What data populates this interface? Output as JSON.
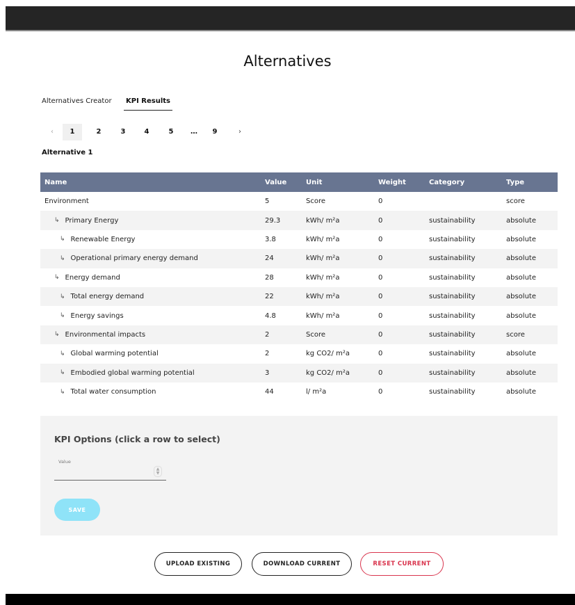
{
  "page": {
    "title": "Alternatives"
  },
  "tabs": [
    {
      "label": "Alternatives Creator",
      "active": false
    },
    {
      "label": "KPI Results",
      "active": true
    }
  ],
  "pagination": {
    "prev": "‹",
    "next": "›",
    "items": [
      "1",
      "2",
      "3",
      "4",
      "5",
      "…",
      "9"
    ],
    "current": "1"
  },
  "alternative": {
    "title": "Alternative 1"
  },
  "table": {
    "headers": {
      "name": "Name",
      "value": "Value",
      "unit": "Unit",
      "weight": "Weight",
      "category": "Category",
      "type": "Type"
    },
    "rows": [
      {
        "name": "Environment",
        "value": "5",
        "unit": "Score",
        "weight": "0",
        "category": "",
        "type": "score"
      },
      {
        "name": "Primary Energy",
        "value": "29.3",
        "unit": "kWh/ m²a",
        "weight": "0",
        "category": "sustainability",
        "type": "absolute"
      },
      {
        "name": "Renewable Energy",
        "value": "3.8",
        "unit": "kWh/ m²a",
        "weight": "0",
        "category": "sustainability",
        "type": "absolute"
      },
      {
        "name": "Operational primary energy demand",
        "value": "24",
        "unit": "kWh/ m²a",
        "weight": "0",
        "category": "sustainability",
        "type": "absolute"
      },
      {
        "name": "Energy demand",
        "value": "28",
        "unit": "kWh/ m²a",
        "weight": "0",
        "category": "sustainability",
        "type": "absolute"
      },
      {
        "name": "Total energy demand",
        "value": "22",
        "unit": "kWh/ m²a",
        "weight": "0",
        "category": "sustainability",
        "type": "absolute"
      },
      {
        "name": "Energy savings",
        "value": "4.8",
        "unit": "kWh/ m²a",
        "weight": "0",
        "category": "sustainability",
        "type": "absolute"
      },
      {
        "name": "Environmental impacts",
        "value": "2",
        "unit": "Score",
        "weight": "0",
        "category": "sustainability",
        "type": "score"
      },
      {
        "name": "Global warming potential",
        "value": "2",
        "unit": "kg CO2/ m²a",
        "weight": "0",
        "category": "sustainability",
        "type": "absolute"
      },
      {
        "name": "Embodied global warming potential",
        "value": "3",
        "unit": "kg CO2/ m²a",
        "weight": "0",
        "category": "sustainability",
        "type": "absolute"
      },
      {
        "name": "Total water consumption",
        "value": "44",
        "unit": "l/ m²a",
        "weight": "0",
        "category": "sustainability",
        "type": "absolute"
      }
    ],
    "child_marker": "↳",
    "row_levels": [
      0,
      1,
      2,
      2,
      1,
      2,
      2,
      1,
      2,
      2,
      2
    ]
  },
  "kpi_options": {
    "title": "KPI Options (click a row to select)",
    "value_label": "Value",
    "value": "",
    "save_label": "SAVE"
  },
  "actions": {
    "upload_label": "UPLOAD EXISTING",
    "download_label": "DOWNLOAD CURRENT",
    "reset_label": "RESET CURRENT"
  },
  "colors": {
    "header_bg": "#687591",
    "save_bg": "#8fe3f8",
    "reset": "#d9344d"
  }
}
